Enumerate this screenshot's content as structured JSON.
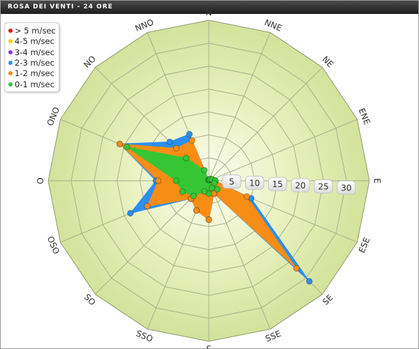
{
  "title": "ROSA DEI VENTI - 24 ORE",
  "chart_data": {
    "type": "area",
    "subtype": "polar-wind-rose",
    "directions": [
      "N",
      "NNE",
      "NE",
      "ENE",
      "E",
      "ESE",
      "SE",
      "SSE",
      "S",
      "SSO",
      "SO",
      "OSO",
      "O",
      "ONO",
      "NO",
      "NNO"
    ],
    "radial_axis": {
      "ticks": [
        5,
        10,
        15,
        20,
        25,
        30
      ],
      "max": 35
    },
    "legend_position": "top-left",
    "grid": true,
    "series": [
      {
        "name": "> 5 m/sec",
        "color": "#e8171b",
        "values": [
          0,
          0,
          0,
          0,
          0,
          0,
          0,
          0,
          0,
          0,
          0,
          0,
          0,
          0,
          0,
          0
        ]
      },
      {
        "name": "4-5 m/sec",
        "color": "#f3d20f",
        "values": [
          0,
          0,
          0,
          0,
          0,
          0,
          0,
          0,
          0,
          0,
          0,
          0,
          0,
          0,
          0,
          0
        ]
      },
      {
        "name": "3-4 m/sec",
        "color": "#8e33d8",
        "values": [
          0,
          0,
          0,
          0,
          0,
          0,
          0,
          0,
          0,
          0,
          0,
          0,
          0,
          0,
          0,
          0
        ]
      },
      {
        "name": "2-3 m/sec",
        "color": "#2b8ff0",
        "values": [
          0.2,
          0.3,
          0.5,
          0.8,
          1.4,
          10,
          31,
          3,
          8.5,
          7,
          5.5,
          18.5,
          11.5,
          21,
          12,
          11
        ]
      },
      {
        "name": "1-2 m/sec",
        "color": "#f78d15",
        "values": [
          0.2,
          0.3,
          0.5,
          0.8,
          1.4,
          9,
          27,
          3,
          8.5,
          7,
          5.5,
          14.5,
          11,
          21,
          10,
          9.5
        ]
      },
      {
        "name": "0-1 m/sec",
        "color": "#35c535",
        "values": [
          0.2,
          0.3,
          0.5,
          0.8,
          1.4,
          1.3,
          2.6,
          1.7,
          2.8,
          2.5,
          4.7,
          6.2,
          7.1,
          19.3,
          7,
          2.5
        ]
      }
    ]
  }
}
